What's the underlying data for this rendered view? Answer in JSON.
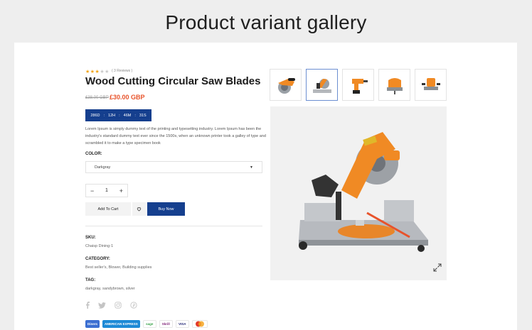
{
  "banner": {
    "title": "Product variant gallery"
  },
  "product": {
    "rating_stars": "★★★",
    "rating_empty": "★★",
    "reviews": "( 3 Reviews )",
    "title": "Wood Cutting Circular Saw Blades",
    "old_price": "£38.00 GBP",
    "new_price": "£30.00 GBP",
    "countdown": [
      "286D",
      ":",
      "12H",
      ":",
      "46M",
      ":",
      "31S"
    ],
    "description": "Lorem Ipsum is simply dummy text of the printing and typesetting industry. Lorem Ipsum has been the industry's standard dummy text ever since the 1500s, when an unknown printer took a galley of type and scrambled it to make a type specimen book",
    "color_label": "COLOR:",
    "color_value": "Darkgray",
    "quantity": "1",
    "qty_minus": "−",
    "qty_plus": "+",
    "add_to_cart": "Add To Cart",
    "buy_now": "Buy Now",
    "sku_label": "SKU:",
    "sku_value": "Chaisp Dining-1",
    "category_label": "CATEGORY:",
    "category_value": "Best seller's, Blower, Building supplies",
    "tag_label": "TAG:",
    "tag_value": "darkgray, sandybrown, silver"
  },
  "social_icons": [
    "facebook-icon",
    "twitter-icon",
    "instagram-icon",
    "pinterest-icon"
  ],
  "payments": [
    {
      "label": "Diners",
      "bg": "#3b6ed1",
      "fg": "#ffffff"
    },
    {
      "label": "AMERICAN EXPRESS",
      "bg": "#1d8ad6",
      "fg": "#ffffff"
    },
    {
      "label": "sage",
      "bg": "#ffffff",
      "fg": "#3aa34a"
    },
    {
      "label": "Skrill",
      "bg": "#ffffff",
      "fg": "#7f2378"
    },
    {
      "label": "VISA",
      "bg": "#ffffff",
      "fg": "#1a1f71"
    },
    {
      "label": "MC",
      "bg": "#ffffff",
      "fg": "#e8532b"
    }
  ],
  "gallery": {
    "thumbnails": [
      "circular-saw",
      "miter-saw",
      "cordless-drill",
      "jigsaw",
      "router"
    ],
    "active_index": 1
  },
  "colors": {
    "accent": "#153f8e",
    "price": "#e8532b",
    "tool_orange": "#f08a24",
    "star": "#f2a516"
  }
}
